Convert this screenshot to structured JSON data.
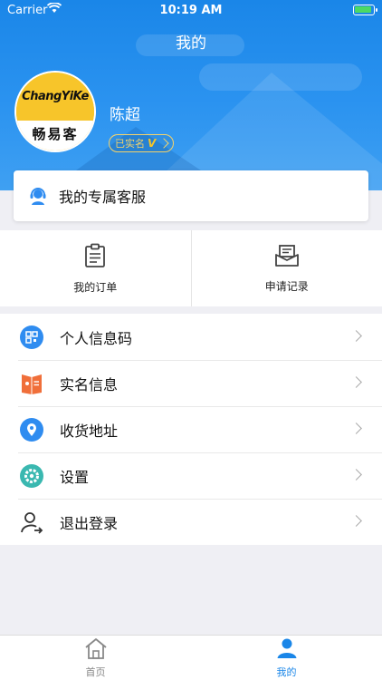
{
  "status_bar": {
    "carrier": "Carrier",
    "time": "10:19 AM"
  },
  "nav": {
    "title": "我的"
  },
  "profile": {
    "avatar_brand": "ChangYiKe",
    "avatar_name": "畅易客",
    "username": "陈超",
    "verify_label": "已实名",
    "verify_mark": "V"
  },
  "service": {
    "label": "我的专属客服",
    "icon": "customer-service-icon"
  },
  "quick": [
    {
      "label": "我的订单",
      "icon": "clipboard-icon"
    },
    {
      "label": "申请记录",
      "icon": "envelope-tray-icon"
    }
  ],
  "menu": [
    {
      "label": "个人信息码",
      "icon": "qr-code-icon",
      "color": "#2f8cf0"
    },
    {
      "label": "实名信息",
      "icon": "id-card-icon",
      "color": "#f06f3a"
    },
    {
      "label": "收货地址",
      "icon": "location-pin-icon",
      "color": "#2f8cf0"
    },
    {
      "label": "设置",
      "icon": "gear-icon",
      "color": "#3ab8b0"
    },
    {
      "label": "退出登录",
      "icon": "logout-user-icon",
      "color": "#333333"
    }
  ],
  "tabs": [
    {
      "label": "首页",
      "icon": "home-icon",
      "active": false
    },
    {
      "label": "我的",
      "icon": "user-icon",
      "active": true
    }
  ],
  "colors": {
    "primary": "#1a86e8",
    "verify_gold": "#f4d36b",
    "background": "#efeff4"
  }
}
